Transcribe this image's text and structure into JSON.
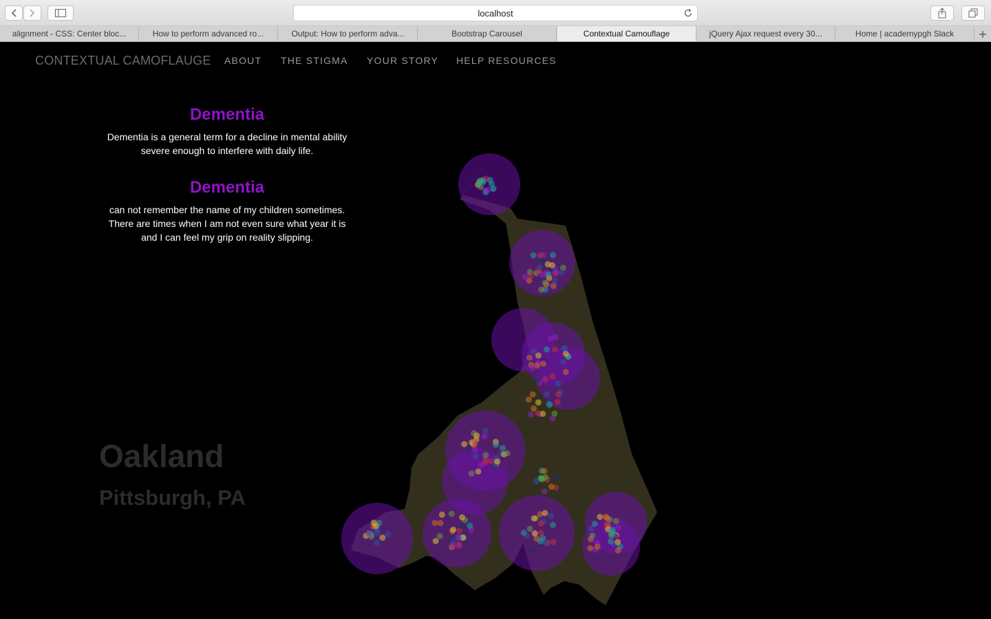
{
  "browser": {
    "address": "localhost",
    "tabs": [
      "alignment - CSS: Center bloc...",
      "How to perform advanced ro...",
      "Output: How to perform adva...",
      "Bootstrap Carousel",
      "Contextual Camouflage",
      "jQuery Ajax request every 30...",
      "Home | academypgh Slack"
    ],
    "active_tab": 4
  },
  "site": {
    "brand": "CONTEXTUAL CAMOFLAUGE",
    "nav": [
      "ABOUT",
      "THE STIGMA",
      "YOUR STORY",
      "HELP RESOURCES"
    ]
  },
  "definition": {
    "title": "Dementia",
    "text": "Dementia is a general term for a decline in mental ability severe enough to interfere with daily life."
  },
  "story": {
    "title": "Dementia",
    "text": "can not remember the name of my children sometimes. There are times when I am not even sure what year it is and I can feel my grip on reality slipping."
  },
  "location": {
    "neighborhood": "Oakland",
    "city": "Pittsburgh, PA"
  },
  "colors": {
    "accent": "#8e14c9",
    "map_fill": "#35331f",
    "cluster": "#6a10a8"
  }
}
